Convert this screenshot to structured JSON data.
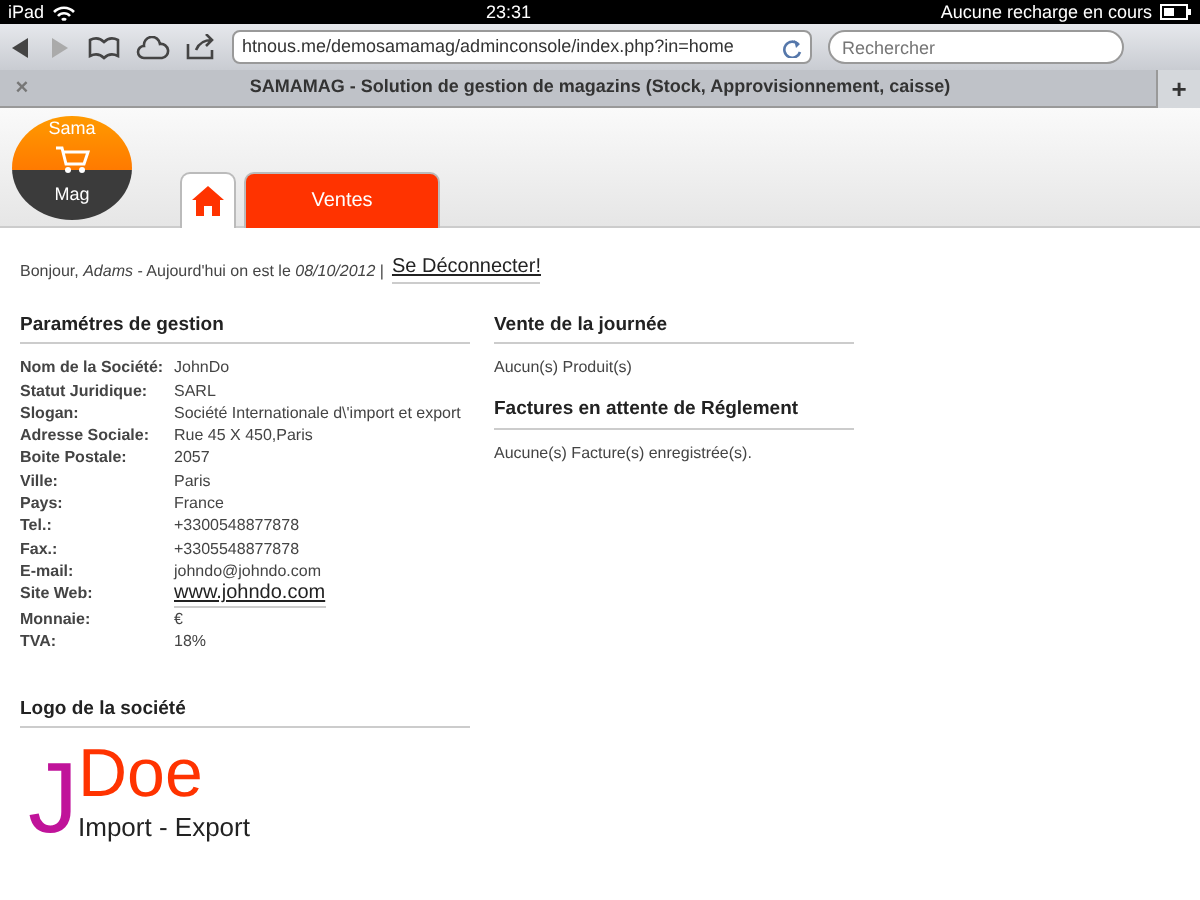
{
  "status_bar": {
    "device": "iPad",
    "time": "23:31",
    "battery": "Aucune recharge en cours"
  },
  "browser": {
    "url": "htnous.me/demosamamag/adminconsole/index.php?in=home",
    "search": {
      "placeholder": "Rechercher"
    },
    "tab_title": "SAMAMAG - Solution de gestion de magazins (Stock, Approvisionnement, caisse)",
    "close": "×",
    "new_tab": "+"
  },
  "logo": {
    "top": "Sama",
    "bottom": "Mag"
  },
  "nav_tabs": [
    {
      "kind": "home",
      "selected": true
    },
    {
      "kind": "text",
      "label": "Ventes",
      "selected": false
    }
  ],
  "greeting": {
    "text": "Bonjour, *Adams* - Aujourd'hui on est le *08/10/2012* |",
    "logout": "Se Déconnecter!"
  },
  "parametres": {
    "title": "Paramétres de gestion",
    "rows": [
      {
        "label": "Nom de la Société:",
        "value": "JohnDo"
      },
      {
        "label": "Statut Juridique:",
        "value": "SARL"
      },
      {
        "label": "Slogan:",
        "value": "Société Internationale d\\'import et export"
      },
      {
        "label": "Adresse Sociale:",
        "value": "Rue 45 X 450,Paris"
      },
      {
        "label": "Boite Postale:",
        "value": "2057"
      },
      {
        "label": "Ville:",
        "value": "Paris"
      },
      {
        "label": "Pays:",
        "value": "France"
      },
      {
        "label": "Tel.:",
        "value": "+3300548877878"
      },
      {
        "label": "Fax.:",
        "value": "+3305548877878"
      },
      {
        "label": "E-mail:",
        "value": "johndo@johndo.com"
      },
      {
        "label": "Site Web:",
        "value": "www.johndo.com",
        "kind": "link"
      },
      {
        "label": "Monnaie:",
        "value": "€"
      },
      {
        "label": "TVA:",
        "value": "18%"
      }
    ]
  },
  "logo_section": {
    "title": "Logo de la société",
    "logo": {
      "initial": "J",
      "name": "Doe",
      "tagline": "Import - Export"
    }
  },
  "vente": {
    "title": "Vente de la journée",
    "text": "Aucun(s) Produit(s)"
  },
  "factures": {
    "title": "Factures en attente de Réglement",
    "text": "Aucune(s) Facture(s) enregistrée(s)."
  }
}
